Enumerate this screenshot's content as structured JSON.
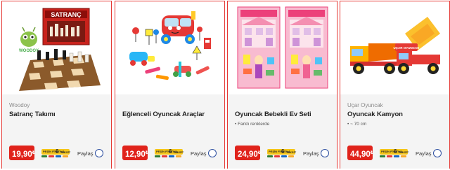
{
  "products": [
    {
      "brand": "Woodoy",
      "title": "Satranç Takımı",
      "note": "",
      "price_main": "19,90",
      "price_currency": "₺",
      "image_box_text": "SATRANÇ",
      "image_logo_text": "WOODOY",
      "taksit": {
        "prefix": "PEŞİN FİYATINA",
        "count": "6",
        "word": "TAKSİT"
      },
      "share_label": "Paylaş"
    },
    {
      "brand": "",
      "title": "Eğlenceli Oyuncak Araçlar",
      "note": "",
      "price_main": "12,90",
      "price_currency": "₺",
      "taksit": {
        "prefix": "PEŞİN FİYATINA",
        "count": "6",
        "word": "TAKSİT"
      },
      "share_label": "Paylaş"
    },
    {
      "brand": "",
      "title": "Oyuncak Bebekli Ev Seti",
      "note": "• Farklı renklerde",
      "price_main": "24,90",
      "price_currency": "₺",
      "taksit": {
        "prefix": "PEŞİN FİYATINA",
        "count": "6",
        "word": "TAKSİT"
      },
      "share_label": "Paylaş"
    },
    {
      "brand": "Uçar Oyuncak",
      "title": "Oyuncak Kamyon",
      "note": "• ~ 70 cm",
      "price_main": "44,90",
      "price_currency": "₺",
      "image_badge_text": "UÇAR OYUNCAK",
      "taksit": {
        "prefix": "PEŞİN FİYATINA",
        "count": "6",
        "word": "TAKSİT"
      },
      "share_label": "Paylaş"
    }
  ],
  "colors": {
    "card_border": "#e53935",
    "price_bg": "#e0231b",
    "info_bg": "#f4f4f4",
    "taksit_bg": "#f5c518",
    "share_circle": "#2d4fa0"
  },
  "icons": [
    "share-radio-icon"
  ]
}
